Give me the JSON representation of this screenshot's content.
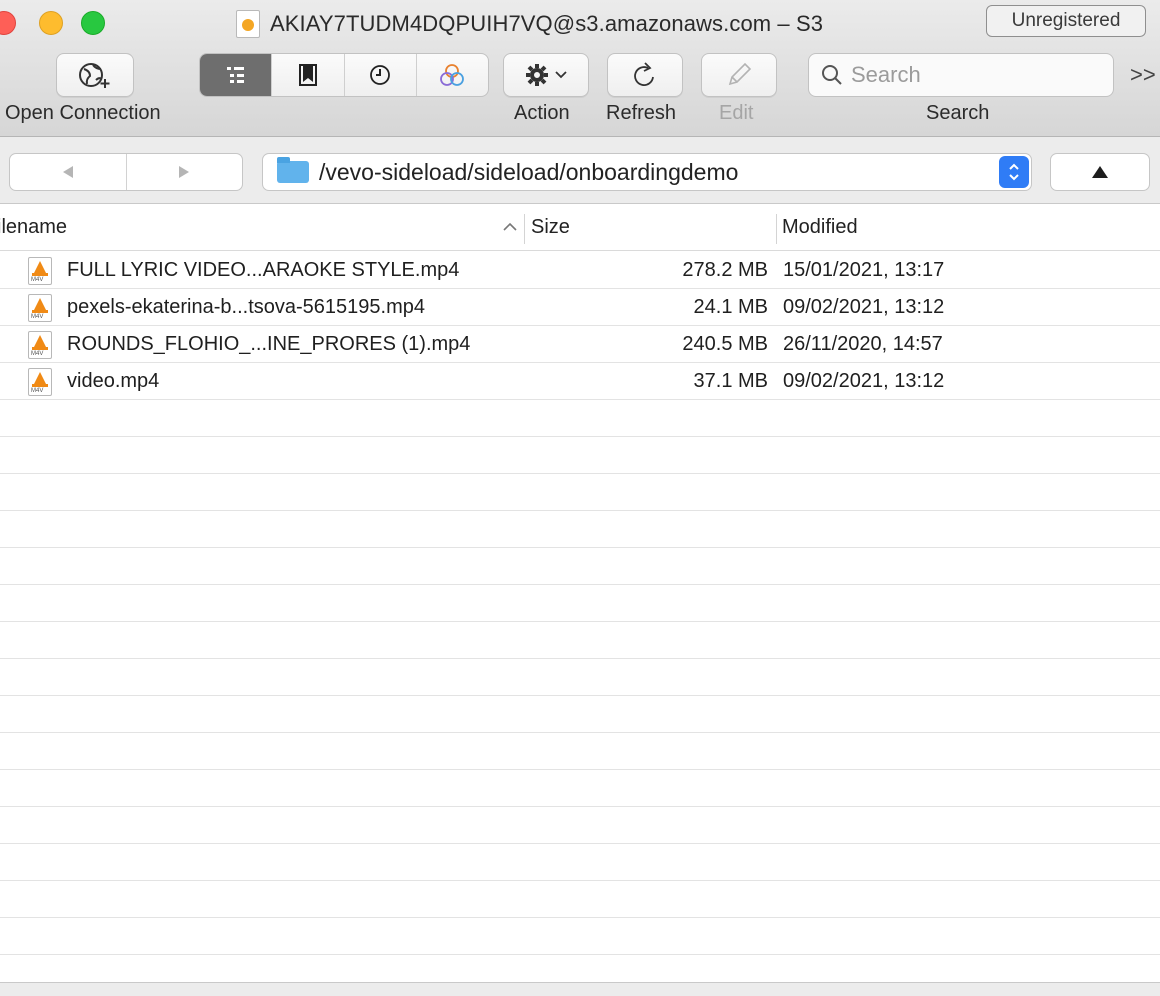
{
  "window": {
    "title": "AKIAY7TUDM4DQPUIH7VQ@s3.amazonaws.com – S3",
    "unregistered_label": "Unregistered"
  },
  "toolbar": {
    "open_connection_label": "Open Connection",
    "action_label": "Action",
    "refresh_label": "Refresh",
    "edit_label": "Edit",
    "search_label": "Search",
    "search_placeholder": "Search",
    "overflow_glyph": ">>",
    "view_modes": [
      "outline-view-icon",
      "bookmarks-icon",
      "history-icon",
      "bonjour-icon"
    ]
  },
  "navigation": {
    "path": "/vevo-sideload/sideload/onboardingdemo"
  },
  "file_list": {
    "columns": {
      "filename": "ilename",
      "size": "Size",
      "modified": "Modified"
    },
    "rows": [
      {
        "name": "FULL LYRIC VIDEO...ARAOKE STYLE.mp4",
        "size": "278.2 MB",
        "modified": "15/01/2021, 13:17"
      },
      {
        "name": "pexels-ekaterina-b...tsova-5615195.mp4",
        "size": "24.1 MB",
        "modified": "09/02/2021, 13:12"
      },
      {
        "name": "ROUNDS_FLOHIO_...INE_PRORES (1).mp4",
        "size": "240.5 MB",
        "modified": "26/11/2020, 14:57"
      },
      {
        "name": "video.mp4",
        "size": "37.1 MB",
        "modified": "09/02/2021, 13:12"
      }
    ],
    "file_type_badge": "M4V"
  },
  "colors": {
    "accent": "#2f7cf6",
    "folder": "#61b3ec",
    "vlc_orange": "#f08a15"
  }
}
